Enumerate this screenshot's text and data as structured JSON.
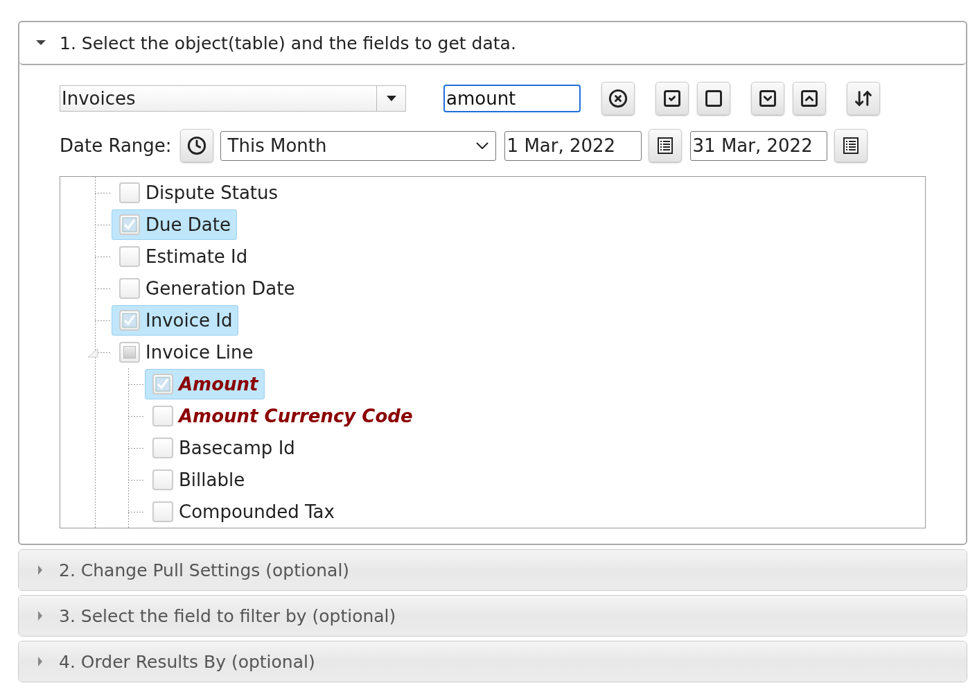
{
  "sections": [
    {
      "title": "1. Select the object(table) and the fields to get data.",
      "expanded": true
    },
    {
      "title": "2. Change Pull Settings (optional)",
      "expanded": false
    },
    {
      "title": "3. Select the field to filter by (optional)",
      "expanded": false
    },
    {
      "title": "4. Order Results By (optional)",
      "expanded": false
    }
  ],
  "object_select": {
    "value": "Invoices"
  },
  "search": {
    "value": "amount"
  },
  "date_range": {
    "label": "Date Range:",
    "preset": "This Month",
    "from": "1 Mar, 2022",
    "to": "31 Mar, 2022"
  },
  "tree": [
    {
      "label": "Dispute Status",
      "checked": false,
      "selected": false,
      "matched": false
    },
    {
      "label": "Due Date",
      "checked": true,
      "selected": true,
      "matched": false
    },
    {
      "label": "Estimate Id",
      "checked": false,
      "selected": false,
      "matched": false
    },
    {
      "label": "Generation Date",
      "checked": false,
      "selected": false,
      "matched": false
    },
    {
      "label": "Invoice Id",
      "checked": true,
      "selected": true,
      "matched": false
    },
    {
      "label": "Invoice Line",
      "checked": false,
      "partial": true,
      "selected": false,
      "matched": false,
      "expanded": true,
      "children": [
        {
          "label": "Amount",
          "checked": true,
          "selected": true,
          "matched": true
        },
        {
          "label": "Amount Currency Code",
          "checked": false,
          "selected": false,
          "matched": true
        },
        {
          "label": "Basecamp Id",
          "checked": false,
          "selected": false,
          "matched": false
        },
        {
          "label": "Billable",
          "checked": false,
          "selected": false,
          "matched": false
        },
        {
          "label": "Compounded Tax",
          "checked": false,
          "selected": false,
          "matched": false
        }
      ]
    }
  ]
}
